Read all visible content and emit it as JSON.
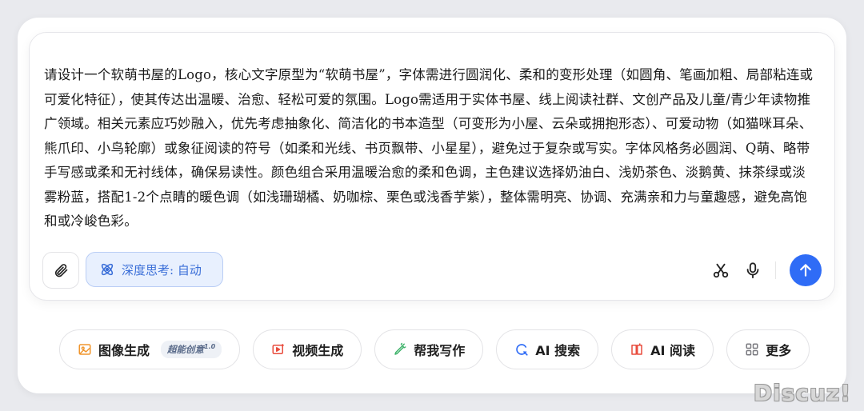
{
  "composer": {
    "prompt_text": "请设计一个软萌书屋的Logo，核心文字原型为“软萌书屋”，字体需进行圆润化、柔和的变形处理（如圆角、笔画加粗、局部粘连或可爱化特征），使其传达出温暖、治愈、轻松可爱的氛围。Logo需适用于实体书屋、线上阅读社群、文创产品及儿童/青少年读物推广领域。相关元素应巧妙融入，优先考虑抽象化、简洁化的书本造型（可变形为小屋、云朵或拥抱形态）、可爱动物（如猫咪耳朵、熊爪印、小鸟轮廓）或象征阅读的符号（如柔和光线、书页飘带、小星星），避免过于复杂或写实。字体风格务必圆润、Q萌、略带手写感或柔和无衬线体，确保易读性。颜色组合采用温暖治愈的柔和色调，主色建议选择奶油白、浅奶茶色、淡鹅黄、抹茶绿或淡雾粉蓝，搭配1-2个点睛的暖色调（如浅珊瑚橘、奶咖棕、栗色或浅香芋紫），整体需明亮、协调、充满亲和力与童趣感，避免高饱和或冷峻色彩。",
    "deep_think_label": "深度思考: 自动",
    "attach_icon": "paperclip-icon",
    "deep_think_icon": "atom-icon",
    "scissor_icon": "scissors-icon",
    "mic_icon": "microphone-icon",
    "send_icon": "arrow-up-icon",
    "accent_color": "#2f6cf6"
  },
  "chips": [
    {
      "label": "图像生成",
      "icon": "image-icon",
      "badge": "超能创意",
      "badge_sup": "1.0",
      "icon_color": "#f0962e"
    },
    {
      "label": "视频生成",
      "icon": "video-icon",
      "icon_color": "#e84c3d"
    },
    {
      "label": "帮我写作",
      "icon": "pen-icon",
      "icon_color": "#3fb36b"
    },
    {
      "label": "AI 搜索",
      "icon": "search-icon",
      "icon_color": "#2f6cf6"
    },
    {
      "label": "AI 阅读",
      "icon": "book-icon",
      "icon_color": "#e84c3d"
    },
    {
      "label": "更多",
      "icon": "grid-icon",
      "icon_color": "#7a7a80"
    }
  ],
  "watermark": "Discuz!"
}
